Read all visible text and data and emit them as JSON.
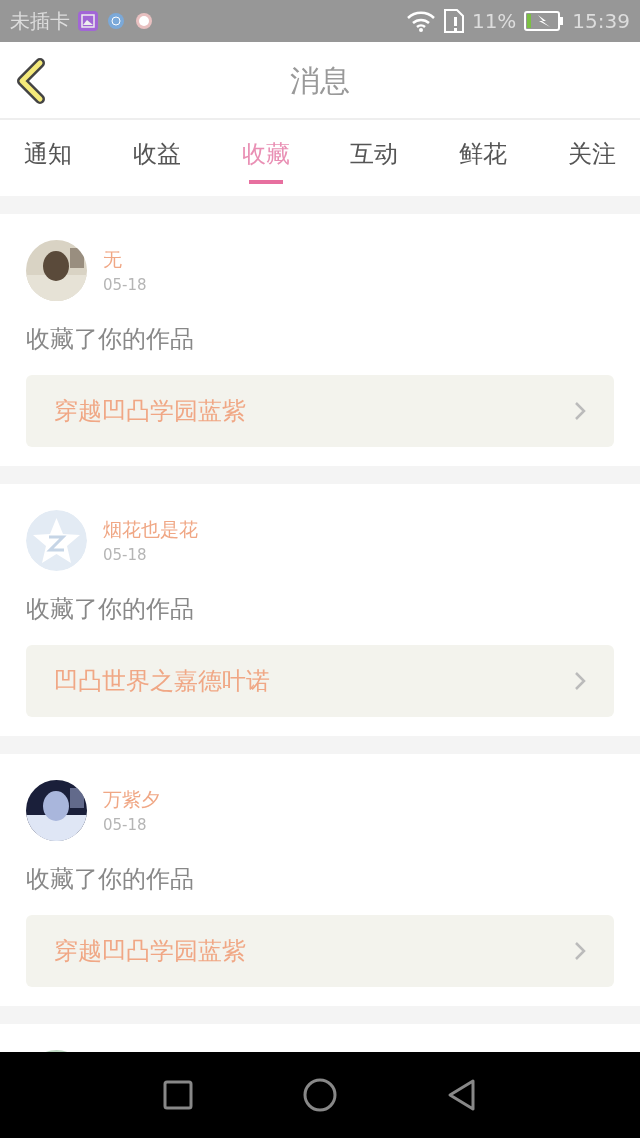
{
  "status_bar": {
    "carrier": "未插卡",
    "battery_text": "11%",
    "time": "15:39"
  },
  "header": {
    "title": "消息"
  },
  "tabs": [
    {
      "label": "通知",
      "selected": false
    },
    {
      "label": "收益",
      "selected": false
    },
    {
      "label": "收藏",
      "selected": true
    },
    {
      "label": "互动",
      "selected": false
    },
    {
      "label": "鲜花",
      "selected": false
    },
    {
      "label": "关注",
      "selected": false
    }
  ],
  "messages": [
    {
      "kind": "picture",
      "name": "无",
      "date": "05-18",
      "text": "收藏了你的作品",
      "work": "穿越凹凸学园蓝紫"
    },
    {
      "kind": "logo",
      "name": "烟花也是花",
      "date": "05-18",
      "text": "收藏了你的作品",
      "work": "凹凸世界之嘉德叶诺"
    },
    {
      "kind": "picture",
      "name": "万紫夕",
      "date": "05-18",
      "text": "收藏了你的作品",
      "work": "穿越凹凸学园蓝紫"
    },
    {
      "kind": "picture"
    }
  ]
}
